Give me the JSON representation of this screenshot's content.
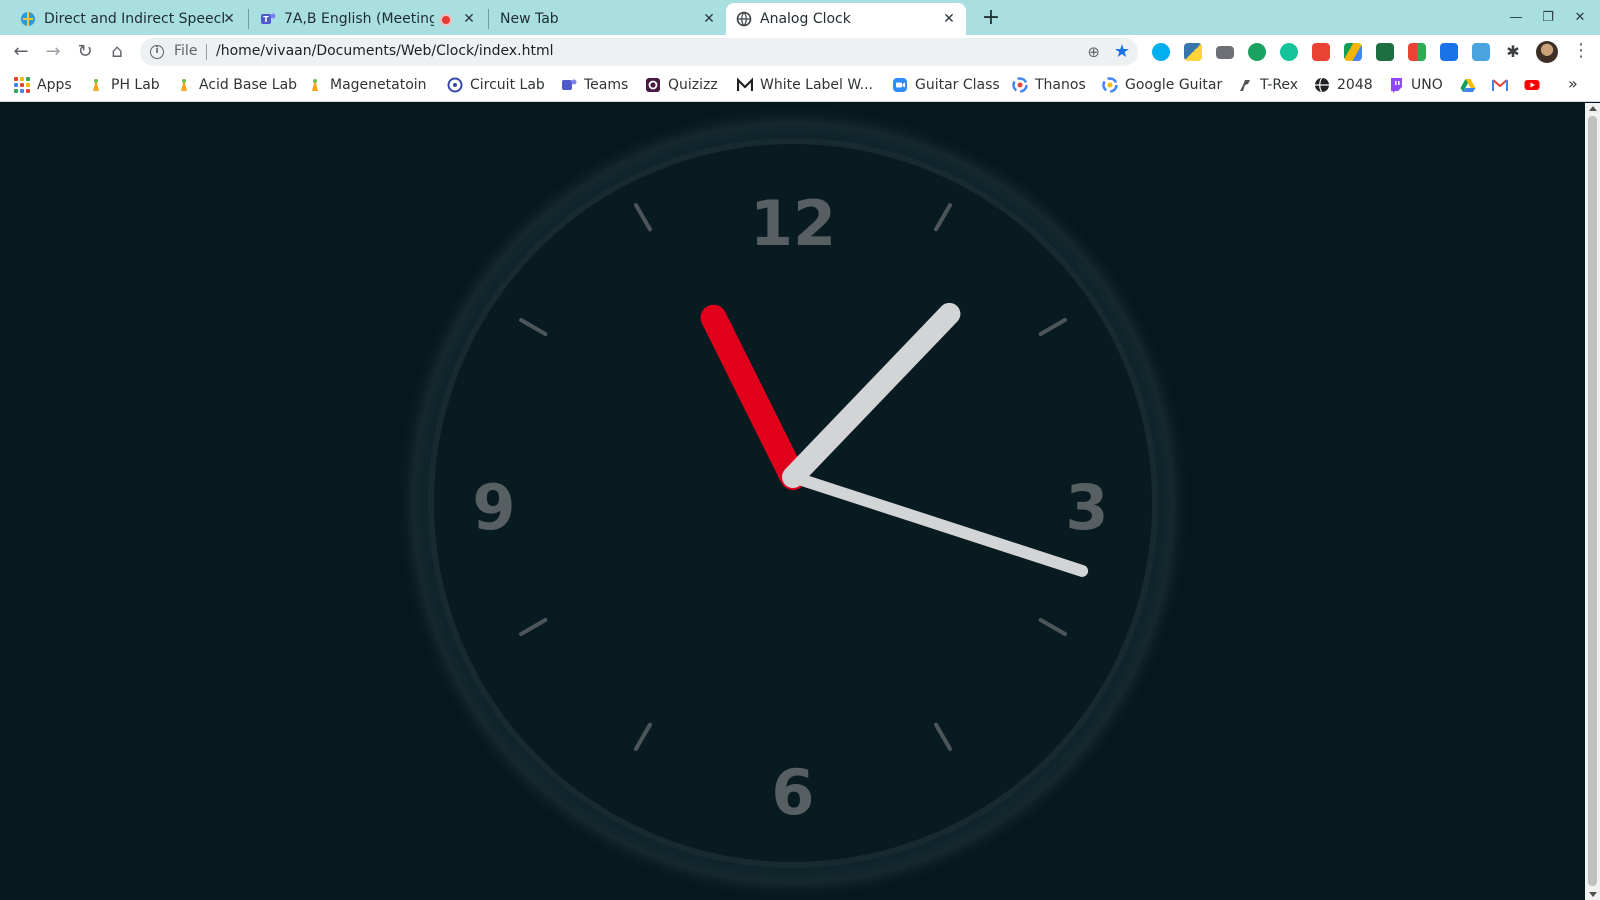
{
  "browser": {
    "tabs": [
      {
        "title": "Direct and Indirect Speech",
        "favicon": "globe-blue-icon",
        "active": false,
        "recording": false
      },
      {
        "title": "7A,B English (Meeting",
        "favicon": "teams-icon",
        "active": false,
        "recording": true
      },
      {
        "title": "New Tab",
        "favicon": "",
        "active": false,
        "recording": false
      },
      {
        "title": "Analog Clock",
        "favicon": "globe-icon",
        "active": true,
        "recording": false
      }
    ],
    "address_bar": {
      "scheme_label": "File",
      "url": "/home/vivaan/Documents/Web/Clock/index.html"
    },
    "bookmarks": [
      {
        "label": "Apps",
        "icon": "apps-grid-icon"
      },
      {
        "label": "PH Lab",
        "icon": "phet-icon"
      },
      {
        "label": "Acid Base Lab",
        "icon": "phet-icon"
      },
      {
        "label": "Magenetatoin",
        "icon": "phet-icon"
      },
      {
        "label": "Circuit Lab",
        "icon": "circle-icon"
      },
      {
        "label": "Teams",
        "icon": "teams-icon"
      },
      {
        "label": "Quizizz",
        "icon": "quizizz-icon"
      },
      {
        "label": "White Label W...",
        "icon": "m-logo-icon"
      },
      {
        "label": "Guitar Class",
        "icon": "zoom-icon"
      },
      {
        "label": "Thanos",
        "icon": "google-icon"
      },
      {
        "label": "Google Guitar",
        "icon": "google-icon"
      },
      {
        "label": "T-Rex",
        "icon": "trex-icon"
      },
      {
        "label": "2048",
        "icon": "globe-dark-icon"
      },
      {
        "label": "UNO",
        "icon": "twitch-icon"
      },
      {
        "label": "",
        "icon": "drive-icon"
      },
      {
        "label": "",
        "icon": "gmail-icon"
      },
      {
        "label": "",
        "icon": "youtube-icon"
      }
    ]
  },
  "clock": {
    "numerals": {
      "twelve": "12",
      "three": "3",
      "six": "6",
      "nine": "9"
    },
    "time": {
      "hours": 11,
      "minutes": 7,
      "seconds": 18
    },
    "colors": {
      "background": "#06171d",
      "face": "#081c22",
      "hour_hand": "#e0001b",
      "minute_hand": "#d2d4d5",
      "second_hand": "#d2d4d5",
      "ticks": "#4d5559",
      "numerals": "#575f63"
    }
  }
}
